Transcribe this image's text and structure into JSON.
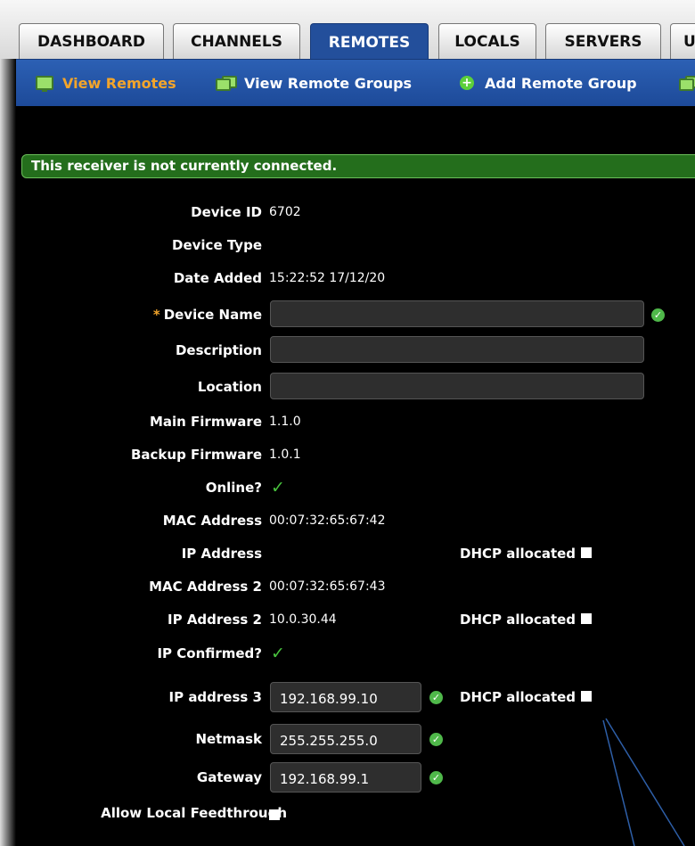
{
  "tabs": [
    {
      "label": "DASHBOARD",
      "active": false
    },
    {
      "label": "CHANNELS",
      "active": false
    },
    {
      "label": "REMOTES",
      "active": true
    },
    {
      "label": "LOCALS",
      "active": false
    },
    {
      "label": "SERVERS",
      "active": false
    },
    {
      "label": "U",
      "active": false
    }
  ],
  "subnav": {
    "view_remotes": "View Remotes",
    "view_remote_groups": "View Remote Groups",
    "add_remote_group": "Add Remote Group"
  },
  "banner": "This receiver is not currently connected.",
  "fields": {
    "device_id": {
      "label": "Device ID",
      "value": "6702"
    },
    "device_type": {
      "label": "Device Type",
      "value": ""
    },
    "date_added": {
      "label": "Date Added",
      "value": "15:22:52 17/12/20"
    },
    "device_name": {
      "label": "Device Name",
      "required_mark": "*",
      "value": ""
    },
    "description": {
      "label": "Description",
      "value": ""
    },
    "location": {
      "label": "Location",
      "value": ""
    },
    "main_firmware": {
      "label": "Main Firmware",
      "value": "1.1.0"
    },
    "backup_firmware": {
      "label": "Backup Firmware",
      "value": "1.0.1"
    },
    "online": {
      "label": "Online?",
      "checked": true
    },
    "mac_address": {
      "label": "MAC Address",
      "value": "00:07:32:65:67:42"
    },
    "ip_address": {
      "label": "IP Address",
      "value": "",
      "dhcp_label": "DHCP allocated",
      "dhcp_checked": false
    },
    "mac_address_2": {
      "label": "MAC Address 2",
      "value": "00:07:32:65:67:43"
    },
    "ip_address_2": {
      "label": "IP Address 2",
      "value": "10.0.30.44",
      "dhcp_label": "DHCP allocated",
      "dhcp_checked": false
    },
    "ip_confirmed": {
      "label": "IP Confirmed?",
      "checked": true
    },
    "ip_address_3": {
      "label": "IP address 3",
      "value": "192.168.99.10",
      "dhcp_label": "DHCP allocated",
      "dhcp_checked": false
    },
    "netmask": {
      "label": "Netmask",
      "value": "255.255.255.0"
    },
    "gateway": {
      "label": "Gateway",
      "value": "192.168.99.1"
    },
    "allow_local_feedthrough": {
      "label": "Allow Local Feedthrough",
      "checked": false
    }
  },
  "colors": {
    "tab_active": "#234f9b",
    "subnav_active": "#f3a52b",
    "banner": "#246e1c",
    "valid": "#4fb84a",
    "annotation_arrow": "#2e5fa8"
  },
  "icons": {
    "view_remotes": "monitor-icon",
    "view_remote_groups": "monitors-icon",
    "add_remote_group": "plus-circle-icon",
    "valid": "check-circle-icon",
    "online": "checkmark-icon"
  }
}
